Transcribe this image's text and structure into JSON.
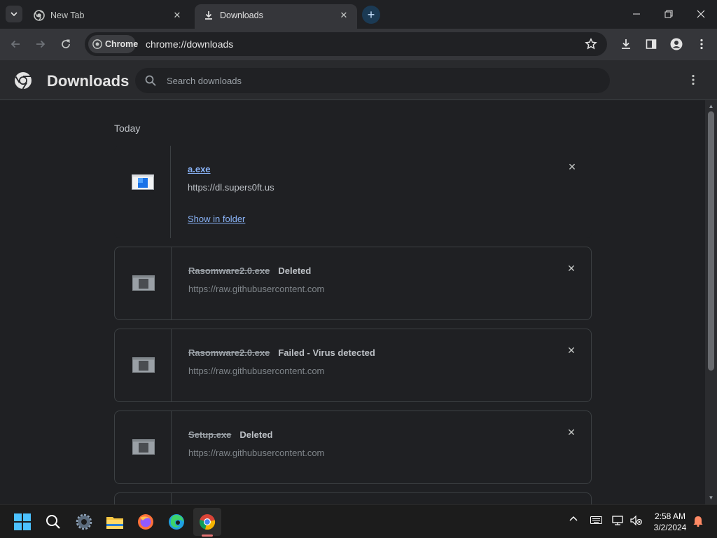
{
  "browser": {
    "tabs": [
      {
        "label": "New Tab",
        "active": false
      },
      {
        "label": "Downloads",
        "active": true
      }
    ],
    "omnibox": {
      "chip_label": "Chrome",
      "url": "chrome://downloads"
    }
  },
  "downloads_page": {
    "title": "Downloads",
    "search_placeholder": "Search downloads",
    "section_label": "Today",
    "items": [
      {
        "filename": "a.exe",
        "status": "",
        "source": "https://dl.supers0ft.us",
        "action": "Show in folder"
      },
      {
        "filename": "Rasomware2.0.exe",
        "status": "Deleted",
        "source": "https://raw.githubusercontent.com"
      },
      {
        "filename": "Rasomware2.0.exe",
        "status": "Failed - Virus detected",
        "source": "https://raw.githubusercontent.com"
      },
      {
        "filename": "Setup.exe",
        "status": "Deleted",
        "source": "https://raw.githubusercontent.com"
      }
    ]
  },
  "taskbar": {
    "time": "2:58 AM",
    "date": "3/2/2024"
  },
  "colors": {
    "link": "#8ab4f8",
    "background": "#1f2023",
    "toolbar": "#35363a"
  }
}
